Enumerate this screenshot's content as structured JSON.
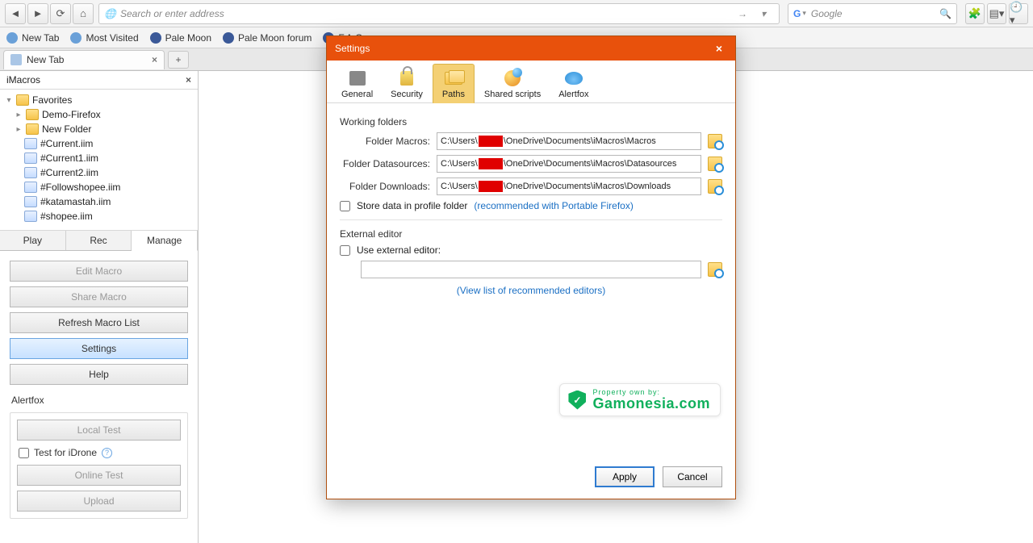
{
  "toolbar": {
    "url_placeholder": "Search or enter address",
    "search_placeholder": "Google",
    "search_engine_glyph": "G"
  },
  "bookmarks": [
    {
      "label": "New Tab"
    },
    {
      "label": "Most Visited"
    },
    {
      "label": "Pale Moon"
    },
    {
      "label": "Pale Moon forum"
    },
    {
      "label": "F.A.Q"
    }
  ],
  "tab": {
    "title": "New Tab"
  },
  "sidebar": {
    "title": "iMacros",
    "tree_root": "Favorites",
    "folders": [
      "Demo-Firefox",
      "New Folder"
    ],
    "files": [
      "#Current.iim",
      "#Current1.iim",
      "#Current2.iim",
      "#Followshopee.iim",
      "#katamastah.iim",
      "#shopee.iim"
    ],
    "tabs": {
      "play": "Play",
      "rec": "Rec",
      "manage": "Manage"
    },
    "buttons": {
      "edit": "Edit Macro",
      "share": "Share Macro",
      "refresh": "Refresh Macro List",
      "settings": "Settings",
      "help": "Help"
    },
    "alertfox": {
      "label": "Alertfox",
      "local": "Local Test",
      "idrone": "Test for iDrone",
      "online": "Online Test",
      "upload": "Upload"
    }
  },
  "dialog": {
    "title": "Settings",
    "tabs": {
      "general": "General",
      "security": "Security",
      "paths": "Paths",
      "shared": "Shared scripts",
      "alertfox": "Alertfox"
    },
    "working_folders": "Working folders",
    "rows": {
      "macros_label": "Folder Macros:",
      "macros_pre": "C:\\Users\\",
      "macros_post": "\\OneDrive\\Documents\\iMacros\\Macros",
      "ds_label": "Folder Datasources:",
      "ds_pre": "C:\\Users\\",
      "ds_post": "\\OneDrive\\Documents\\iMacros\\Datasources",
      "dl_label": "Folder Downloads:",
      "dl_pre": "C:\\Users\\",
      "dl_post": "\\OneDrive\\Documents\\iMacros\\Downloads"
    },
    "store_profile": "Store data in profile folder",
    "store_link": "(recommended with Portable Firefox)",
    "external_editor": "External editor",
    "use_external": "Use external editor:",
    "editors_link": "(View list of recommended editors)",
    "watermark_small": "Property own by:",
    "watermark_big": "Gamonesia.com",
    "apply": "Apply",
    "cancel": "Cancel"
  }
}
